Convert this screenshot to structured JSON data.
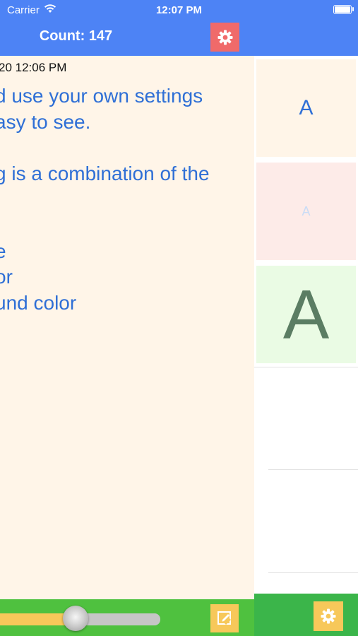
{
  "status_bar": {
    "carrier": "Carrier",
    "time": "12:07 PM"
  },
  "header": {
    "title": "Count: 147"
  },
  "note": {
    "timestamp": "20 12:06 PM",
    "lines": [
      "d use your own settings",
      "asy to see.",
      "g is a combination of the",
      "e",
      "or",
      "und color"
    ]
  },
  "font_size_slider": {
    "value_fraction": 0.46
  },
  "style_presets": [
    {
      "label": "A",
      "background": "#fff5e8",
      "text_color": "#2f6fd6"
    },
    {
      "label": "A",
      "background": "#fdebe8",
      "text_color": "#c9dcf6"
    },
    {
      "label": "A",
      "background": "#eafbe4",
      "text_color": "#5b7d63"
    }
  ],
  "colors": {
    "header": "#4d83f5",
    "note_background": "#fff5e8",
    "note_text": "#2f6fd6",
    "settings_button": "#f06a6a",
    "bottom_bar": "#4fc13f",
    "accent_yellow": "#f7c85a"
  }
}
